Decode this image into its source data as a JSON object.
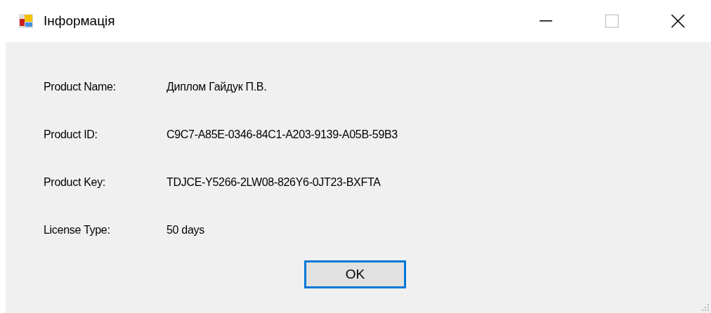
{
  "window": {
    "title": "Інформація",
    "maximize_disabled": true
  },
  "fields": [
    {
      "label": "Product Name:",
      "value": "Диплом Гайдук П.В."
    },
    {
      "label": "Product ID:",
      "value": "C9C7-A85E-0346-84C1-A203-9139-A05B-59B3"
    },
    {
      "label": "Product Key:",
      "value": "TDJCE-Y5266-2LW08-826Y6-0JT23-BXFTA"
    },
    {
      "label": "License Type:",
      "value": "50 days"
    }
  ],
  "buttons": [
    {
      "label": "OK",
      "focused": true
    }
  ]
}
